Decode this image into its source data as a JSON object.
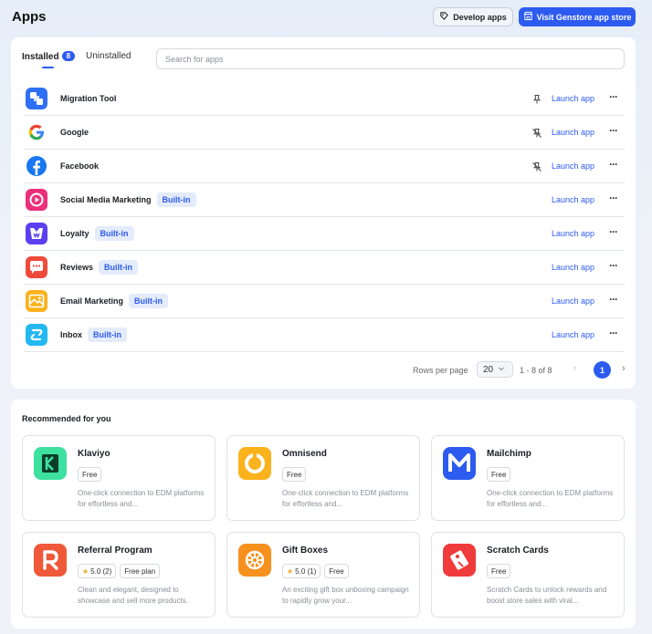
{
  "header": {
    "title": "Apps",
    "develop_label": "Develop apps",
    "store_label": "Visit Genstore app store"
  },
  "tabs": {
    "installed_label": "Installed",
    "installed_count": "8",
    "uninstalled_label": "Uninstalled"
  },
  "search": {
    "placeholder": "Search for apps"
  },
  "apps": [
    {
      "name": "Migration Tool",
      "builtin": "",
      "launch": "Launch app",
      "pinned": true
    },
    {
      "name": "Google",
      "builtin": "",
      "launch": "Launch app",
      "pinned": false
    },
    {
      "name": "Facebook",
      "builtin": "",
      "launch": "Launch app",
      "pinned": false
    },
    {
      "name": "Social Media Marketing",
      "builtin": "Built-in",
      "launch": "Launch app"
    },
    {
      "name": "Loyalty",
      "builtin": "Built-in",
      "launch": "Launch app"
    },
    {
      "name": "Reviews",
      "builtin": "Built-in",
      "launch": "Launch app"
    },
    {
      "name": "Email Marketing",
      "builtin": "Built-in",
      "launch": "Launch app"
    },
    {
      "name": "Inbox",
      "builtin": "Built-in",
      "launch": "Launch app"
    }
  ],
  "pagination": {
    "rows_label": "Rows per page",
    "rows_value": "20",
    "range": "1 - 8 of 8",
    "current_page": "1"
  },
  "recommended": {
    "title": "Recommended for you",
    "items": [
      {
        "name": "Klaviyo",
        "rating": "",
        "tag": "Free",
        "desc": "One-click connection to EDM platforms for effortless and..."
      },
      {
        "name": "Omnisend",
        "rating": "",
        "tag": "Free",
        "desc": "One-click connection to EDM platforms for effortless and..."
      },
      {
        "name": "Mailchimp",
        "rating": "",
        "tag": "Free",
        "desc": "One-click connection to EDM platforms for effortless and..."
      },
      {
        "name": "Referral Program",
        "rating": "5.0 (2)",
        "tag": "Free plan",
        "desc": "Clean and elegant, designed to showcase and sell more products."
      },
      {
        "name": "Gift Boxes",
        "rating": "5.0 (1)",
        "tag": "Free",
        "desc": "An exciting gift box unboxing campaign to rapidly grow your..."
      },
      {
        "name": "Scratch Cards",
        "rating": "",
        "tag": "Free",
        "desc": "Scratch Cards to unlock rewards and boost store sales with viral..."
      }
    ]
  },
  "colors": {
    "accent": "#2d5bf0",
    "builtin_bg": "#e4ebfb",
    "star": "#f5a623"
  }
}
